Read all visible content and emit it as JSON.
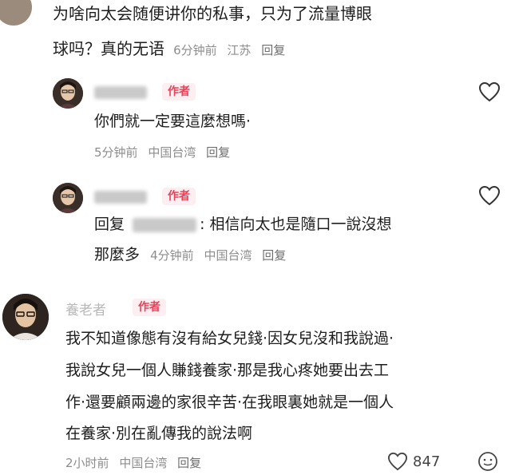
{
  "top_comment": {
    "line1": "为啥向太会随便讲你的私事，只为了流量博眼",
    "line2": "球吗？真的无语",
    "time": "6分钟前",
    "location": "江苏",
    "reply_label": "回复"
  },
  "reply1": {
    "badge": "作者",
    "text": "你們就一定要這麼想嗎·",
    "time": "5分钟前",
    "location": "中国台湾",
    "reply_label": "回复"
  },
  "reply2": {
    "badge": "作者",
    "prefix": "回复",
    "text_after": "相信向太也是隨口一說沒想",
    "line2": "那麼多",
    "time": "4分钟前",
    "location": "中国台湾",
    "reply_label": "回复"
  },
  "author_comment": {
    "username": "養老者",
    "badge": "作者",
    "lines": [
      "我不知道像態有沒有給女兒錢·因女兒沒和我說過·",
      "我說女兒一個人賺錢養家·那是我心疼她要出去工",
      "作·還要顧兩邊的家很辛苦·在我眼裏她就是一個人",
      "在養家·別在亂傳我的說法啊"
    ],
    "time": "2小时前",
    "location": "中国台湾",
    "reply_label": "回复",
    "like_count": "847"
  },
  "colors": {
    "badge_text": "#e8435a",
    "badge_bg": "#fdeff1",
    "meta_text": "#8d8d8d"
  }
}
